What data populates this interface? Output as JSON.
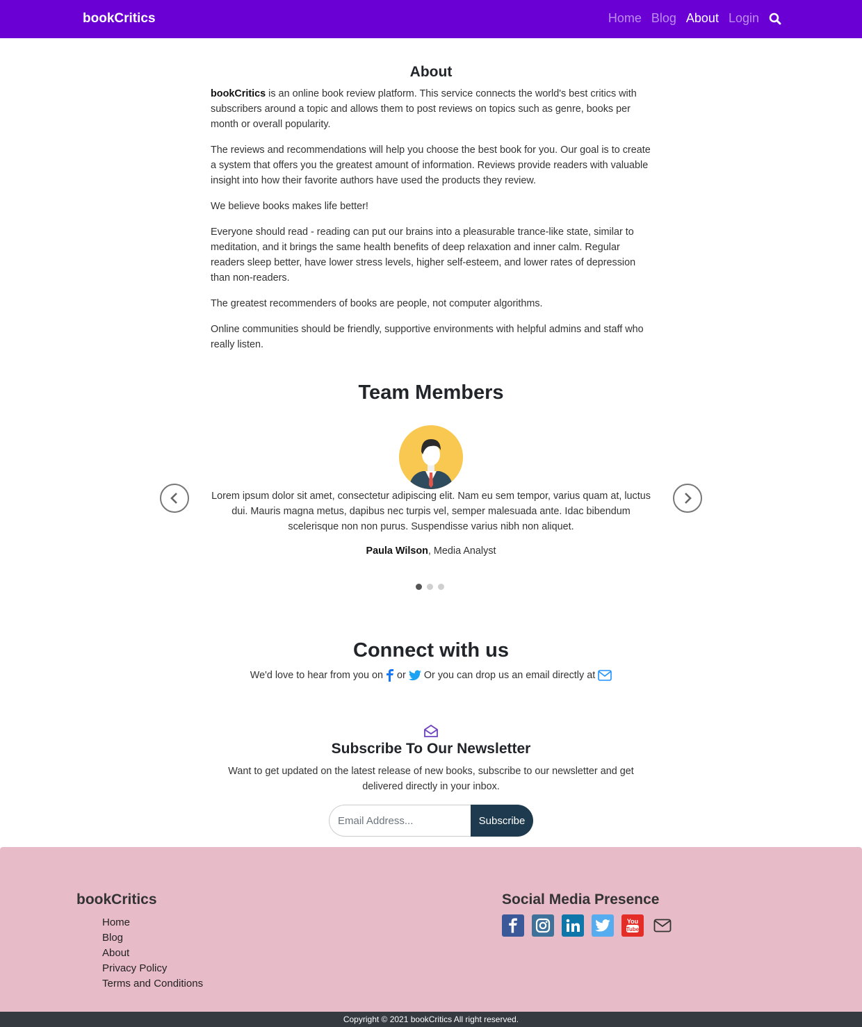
{
  "navbar": {
    "brand": "bookCritics",
    "links": [
      "Home",
      "Blog",
      "About",
      "Login"
    ],
    "active": "About"
  },
  "about": {
    "title": "About",
    "p1_bold": "bookCritics",
    "p1_rest": " is an online book review platform. This service connects the world's best critics with subscribers around a topic and allows them to post reviews on topics such as genre, books per month or overall popularity.",
    "p2": "The reviews and recommendations will help you choose the best book for you. Our goal is to create a system that offers you the greatest amount of information. Reviews provide readers with valuable insight into how their favorite authors have used the products they review.",
    "p3": "We believe books makes life better!",
    "p4": "Everyone should read - reading can put our brains into a pleasurable trance-like state, similar to meditation, and it brings the same health benefits of deep relaxation and inner calm. Regular readers sleep better, have lower stress levels, higher self-esteem, and lower rates of depression than non-readers.",
    "p5": "The greatest recommenders of books are people, not computer algorithms.",
    "p6": "Online communities should be friendly, supportive environments with helpful admins and staff who really listen."
  },
  "team": {
    "title": "Team Members",
    "quote": "Lorem ipsum dolor sit amet, consectetur adipiscing elit. Nam eu sem tempor, varius quam at, luctus dui. Mauris magna metus, dapibus nec turpis vel, semper malesuada ante. Idac bibendum scelerisque non non purus. Suspendisse varius nibh non aliquet.",
    "member_name": "Paula Wilson",
    "member_role": ", Media Analyst",
    "slide_count": 3,
    "active_slide": 1
  },
  "connect": {
    "title": "Connect with us",
    "text_1": "We'd love to hear from you on",
    "text_or": "or",
    "text_2": "Or you can drop us an email directly at"
  },
  "newsletter": {
    "title": "Subscribe To Our Newsletter",
    "text": "Want to get updated on the latest release of new books, subscribe to our newsletter and get delivered directly in your inbox.",
    "placeholder": "Email Address...",
    "button": "Subscribe"
  },
  "footer": {
    "brand": "bookCritics",
    "links": [
      "Home",
      "Blog",
      "About",
      "Privacy Policy",
      "Terms and Conditions"
    ],
    "social_title": "Social Media Presence",
    "social_icons": [
      "facebook-icon",
      "instagram-icon",
      "linkedin-icon",
      "twitter-icon",
      "youtube-icon",
      "email-icon"
    ],
    "colors": {
      "facebook": "#3b5998",
      "instagram": "#3f729b",
      "linkedin": "#0e76a8",
      "twitter": "#55acee",
      "youtube": "#e52d27"
    },
    "copyright": "Copyright © 2021 bookCritics All right reserved."
  },
  "colors": {
    "nav": "#6a00d4",
    "footer": "#e8bbc8",
    "button": "#1e3a4f"
  }
}
